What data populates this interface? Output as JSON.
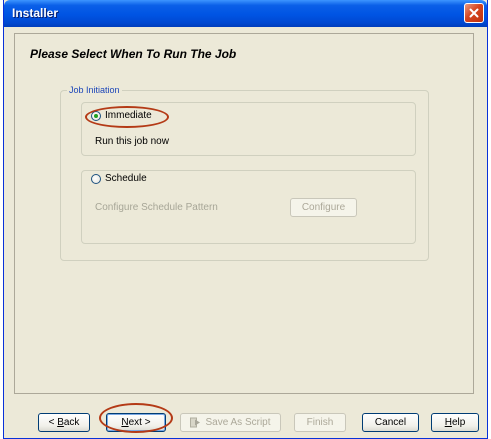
{
  "window": {
    "title": "Installer"
  },
  "page": {
    "heading": "Please Select When To Run The Job"
  },
  "job_initiation": {
    "legend": "Job Initiation",
    "immediate": {
      "label": "Immediate",
      "selected": true,
      "description": "Run this job now"
    },
    "schedule": {
      "label": "Schedule",
      "selected": false,
      "pattern_label": "Configure Schedule Pattern",
      "configure_button": "Configure"
    }
  },
  "buttons": {
    "back": {
      "mnemonic": "B",
      "rest": "ack",
      "prefix": "< "
    },
    "next": {
      "mnemonic": "N",
      "rest": "ext >"
    },
    "save_as_script": "Save As Script",
    "finish": "Finish",
    "cancel": "Cancel",
    "help": {
      "mnemonic": "H",
      "rest": "elp"
    }
  },
  "colors": {
    "titlebar": "#0054e3",
    "highlight_oval": "#b43a16",
    "legend_blue": "#1c46b8",
    "dialog_bg": "#ece9d8"
  },
  "icons": {
    "close": "close-icon",
    "script": "script-play-icon"
  }
}
